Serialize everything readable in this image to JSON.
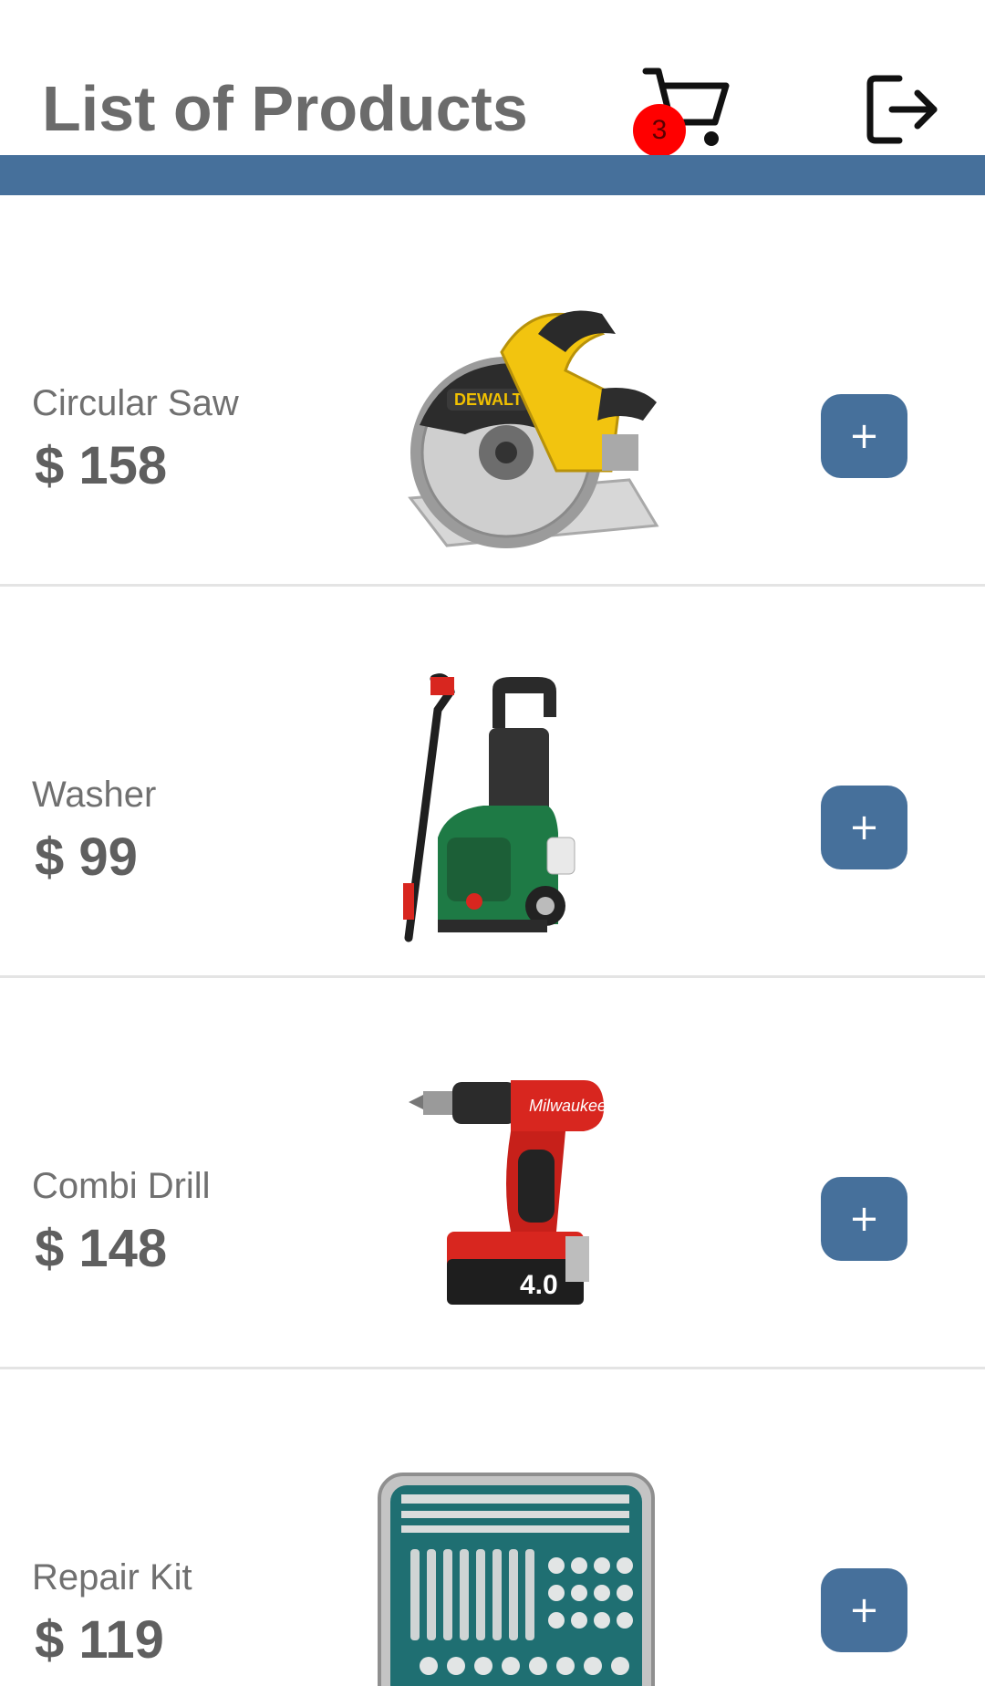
{
  "header": {
    "title": "List of Products",
    "cart_badge_count": "3",
    "cart_icon": "shopping-cart-icon",
    "logout_icon": "logout-arrow-icon"
  },
  "colors": {
    "accent": "#46709b",
    "badge": "#ff0000",
    "title_text": "#6b6b6b"
  },
  "products": [
    {
      "name": "Circular Saw",
      "price": "$ 158",
      "add_label": "+",
      "image": "circular-saw-image"
    },
    {
      "name": "Washer",
      "price": "$ 99",
      "add_label": "+",
      "image": "pressure-washer-image"
    },
    {
      "name": "Combi Drill",
      "price": "$ 148",
      "add_label": "+",
      "image": "combi-drill-image"
    },
    {
      "name": "Repair Kit",
      "price": "$ 119",
      "add_label": "+",
      "image": "repair-kit-image"
    }
  ]
}
